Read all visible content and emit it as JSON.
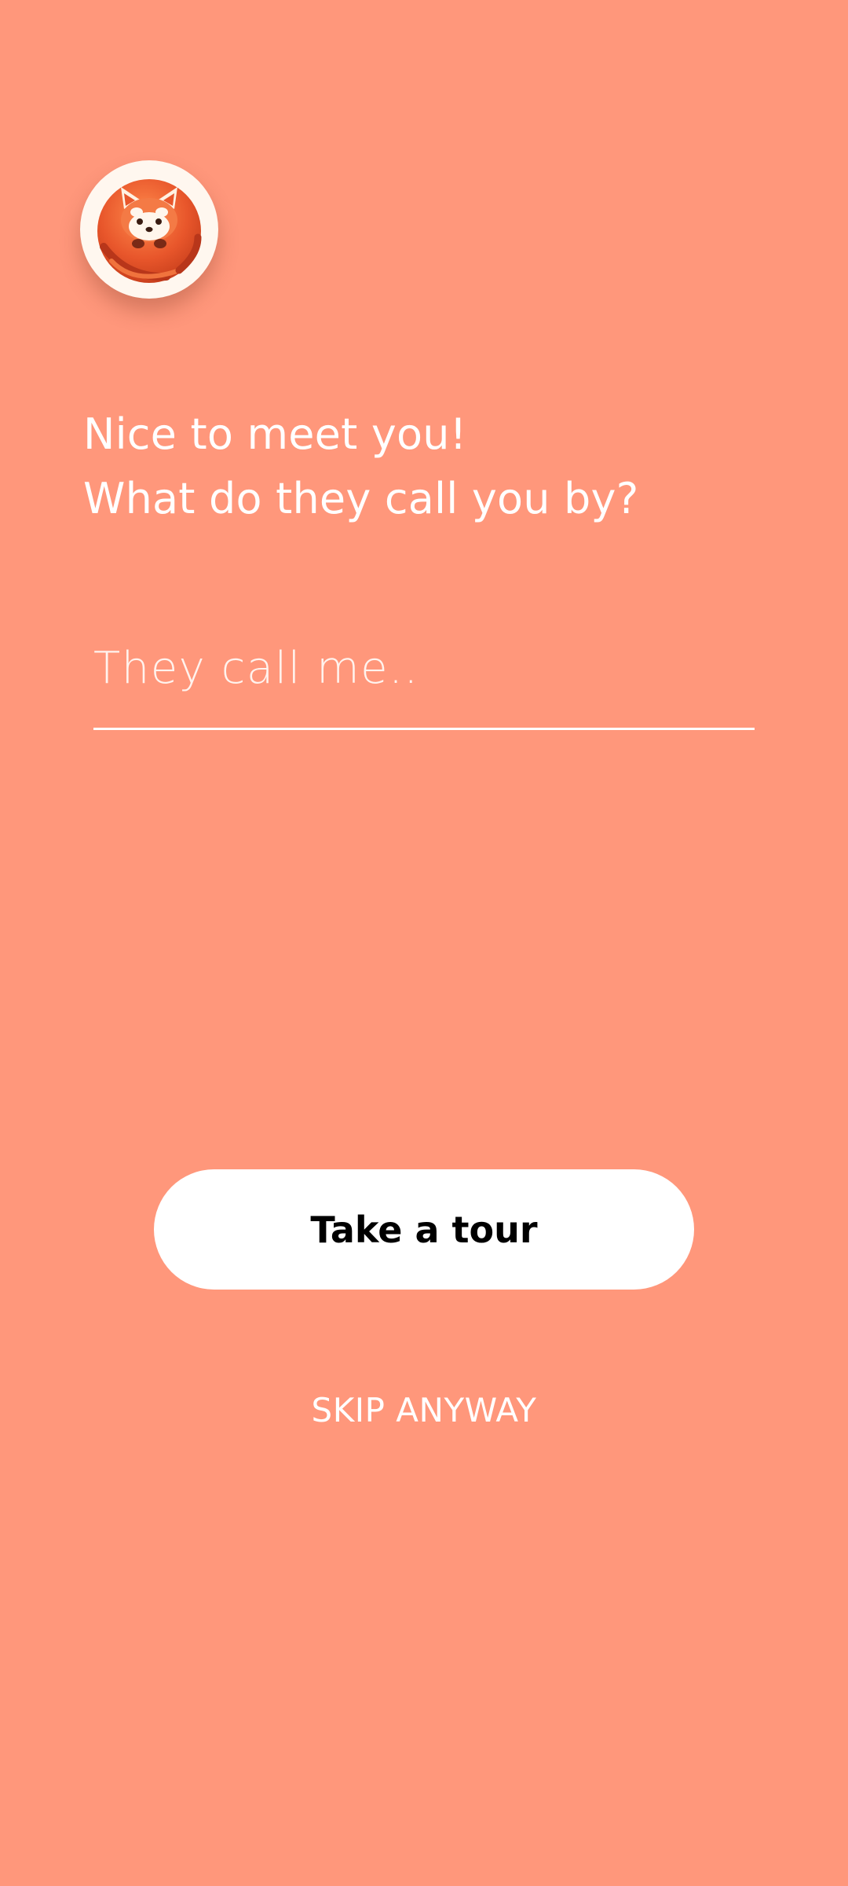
{
  "colors": {
    "background": "#FF977B",
    "text_primary": "#FFFFFF",
    "button_bg": "#FFFFFF",
    "button_text": "#000000",
    "logo_ring": "#FFF7EF",
    "logo_fur": "#E8562B"
  },
  "logo": {
    "icon": "red-panda-icon"
  },
  "greeting": {
    "line1": "Nice to meet you!",
    "line2": "What do they call you by?"
  },
  "name_input": {
    "value": "",
    "placeholder": "They call me.."
  },
  "actions": {
    "tour_label": "Take a tour",
    "skip_label": "SKIP ANYWAY"
  }
}
